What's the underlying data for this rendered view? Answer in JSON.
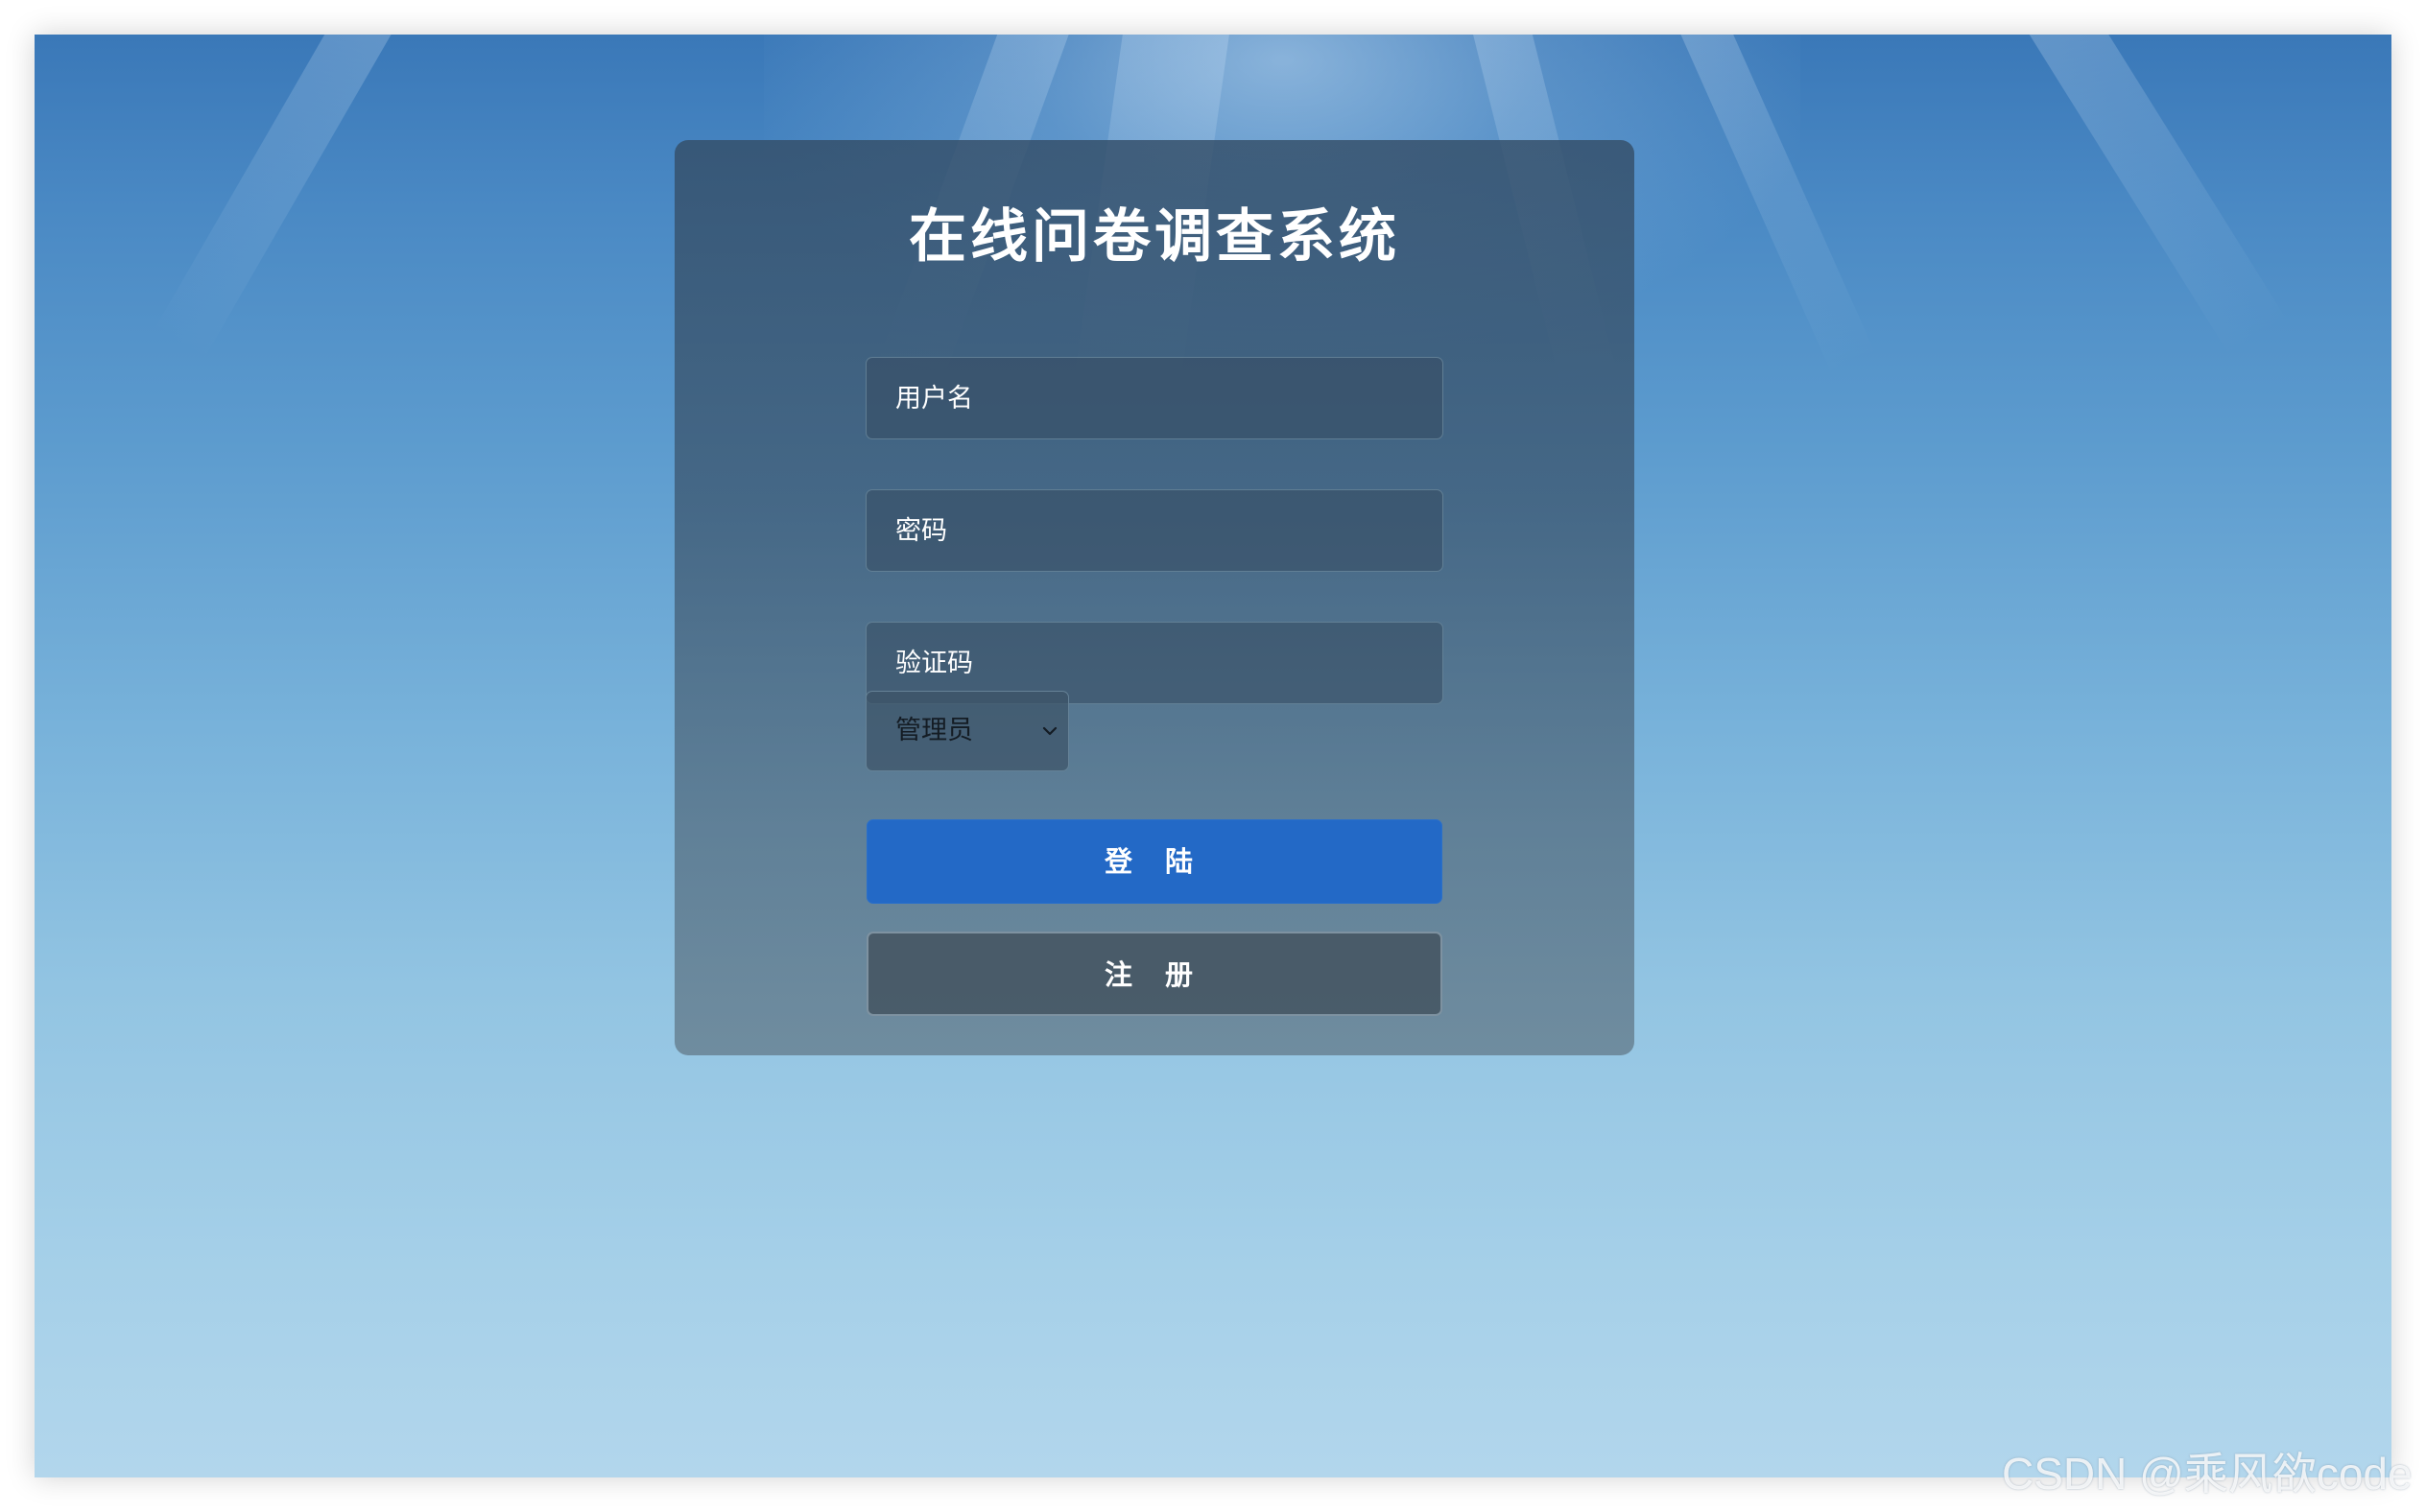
{
  "page": {
    "title": "在线问卷调查系统",
    "watermark": "CSDN @乘风欲code"
  },
  "form": {
    "username_placeholder": "用户名",
    "password_placeholder": "密码",
    "captcha_placeholder": "验证码",
    "role_selected": "管理员",
    "login_label": "登 陆",
    "register_label": "注 册"
  },
  "colors": {
    "login_button": "#2369c6",
    "panel": "#3e5a74",
    "background_top": "#3a78b8",
    "background_bottom": "#b2d6ec"
  },
  "icons": {
    "role_dropdown": "chevron-down-icon"
  }
}
